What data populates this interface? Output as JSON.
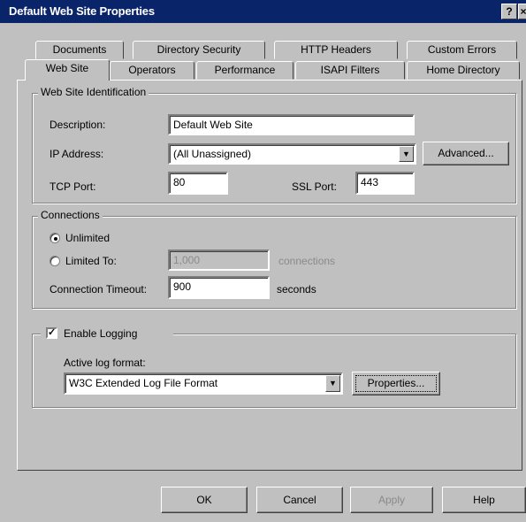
{
  "window": {
    "title": "Default Web Site Properties",
    "help_button": "?",
    "close_button": "×"
  },
  "tabs": {
    "back_row": [
      "Documents",
      "Directory Security",
      "HTTP Headers",
      "Custom Errors"
    ],
    "front_row": [
      "Web Site",
      "Operators",
      "Performance",
      "ISAPI Filters",
      "Home Directory"
    ],
    "active": "Web Site"
  },
  "identification": {
    "legend": "Web Site Identification",
    "description_label": "Description:",
    "description_value": "Default Web Site",
    "ip_label": "IP Address:",
    "ip_value": "(All Unassigned)",
    "advanced_button": "Advanced...",
    "tcp_label": "TCP Port:",
    "tcp_value": "80",
    "ssl_label": "SSL Port:",
    "ssl_value": "443"
  },
  "connections": {
    "legend": "Connections",
    "unlimited_label": "Unlimited",
    "limited_label": "Limited To:",
    "limited_value": "1,000",
    "limited_units": "connections",
    "selected": "Unlimited",
    "timeout_label": "Connection Timeout:",
    "timeout_value": "900",
    "timeout_units": "seconds"
  },
  "logging": {
    "enable_label": "Enable Logging",
    "enabled": true,
    "format_label": "Active log format:",
    "format_value": "W3C Extended Log File Format",
    "properties_button": "Properties..."
  },
  "buttons": {
    "ok": "OK",
    "cancel": "Cancel",
    "apply": "Apply",
    "help": "Help"
  }
}
